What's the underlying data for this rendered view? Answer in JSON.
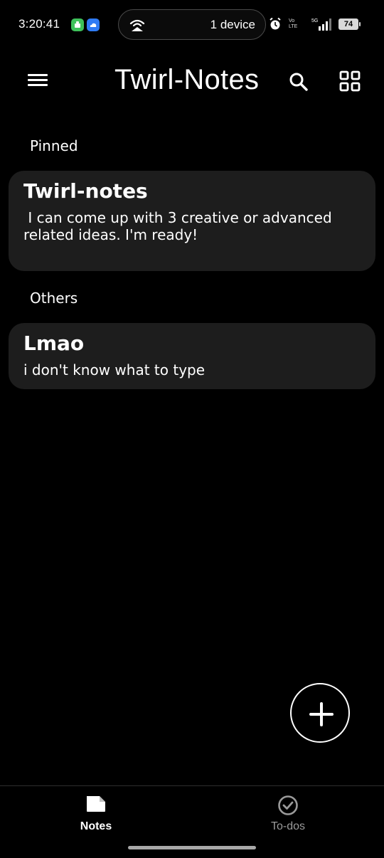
{
  "status_bar": {
    "time": "3:20:41",
    "device_pill": "1 device",
    "battery": "74",
    "volte": "Vo LTE",
    "network": "5G"
  },
  "app_bar": {
    "title": "Twirl-Notes",
    "menu_icon": "hamburger-menu-icon",
    "search_icon": "search-icon",
    "layout_icon": "grid-view-icon"
  },
  "sections": {
    "pinned_label": "Pinned",
    "others_label": "Others"
  },
  "pinned_notes": [
    {
      "title": "Twirl-notes",
      "body": " I can come up with 3 creative or advanced related ideas. I'm ready!"
    }
  ],
  "other_notes": [
    {
      "title": "Lmao",
      "body": "i don't know what to type"
    }
  ],
  "fab": {
    "icon": "plus-icon"
  },
  "bottom_nav": {
    "items": [
      {
        "label": "Notes",
        "icon": "note-icon",
        "active": true
      },
      {
        "label": "To-dos",
        "icon": "check-circle-icon",
        "active": false
      }
    ]
  },
  "colors": {
    "background": "#000000",
    "card": "#1d1d1d",
    "text": "#ffffff",
    "inactive": "#9a9a9a",
    "badge_green": "#3ec15a",
    "badge_blue": "#2f7bf5"
  }
}
